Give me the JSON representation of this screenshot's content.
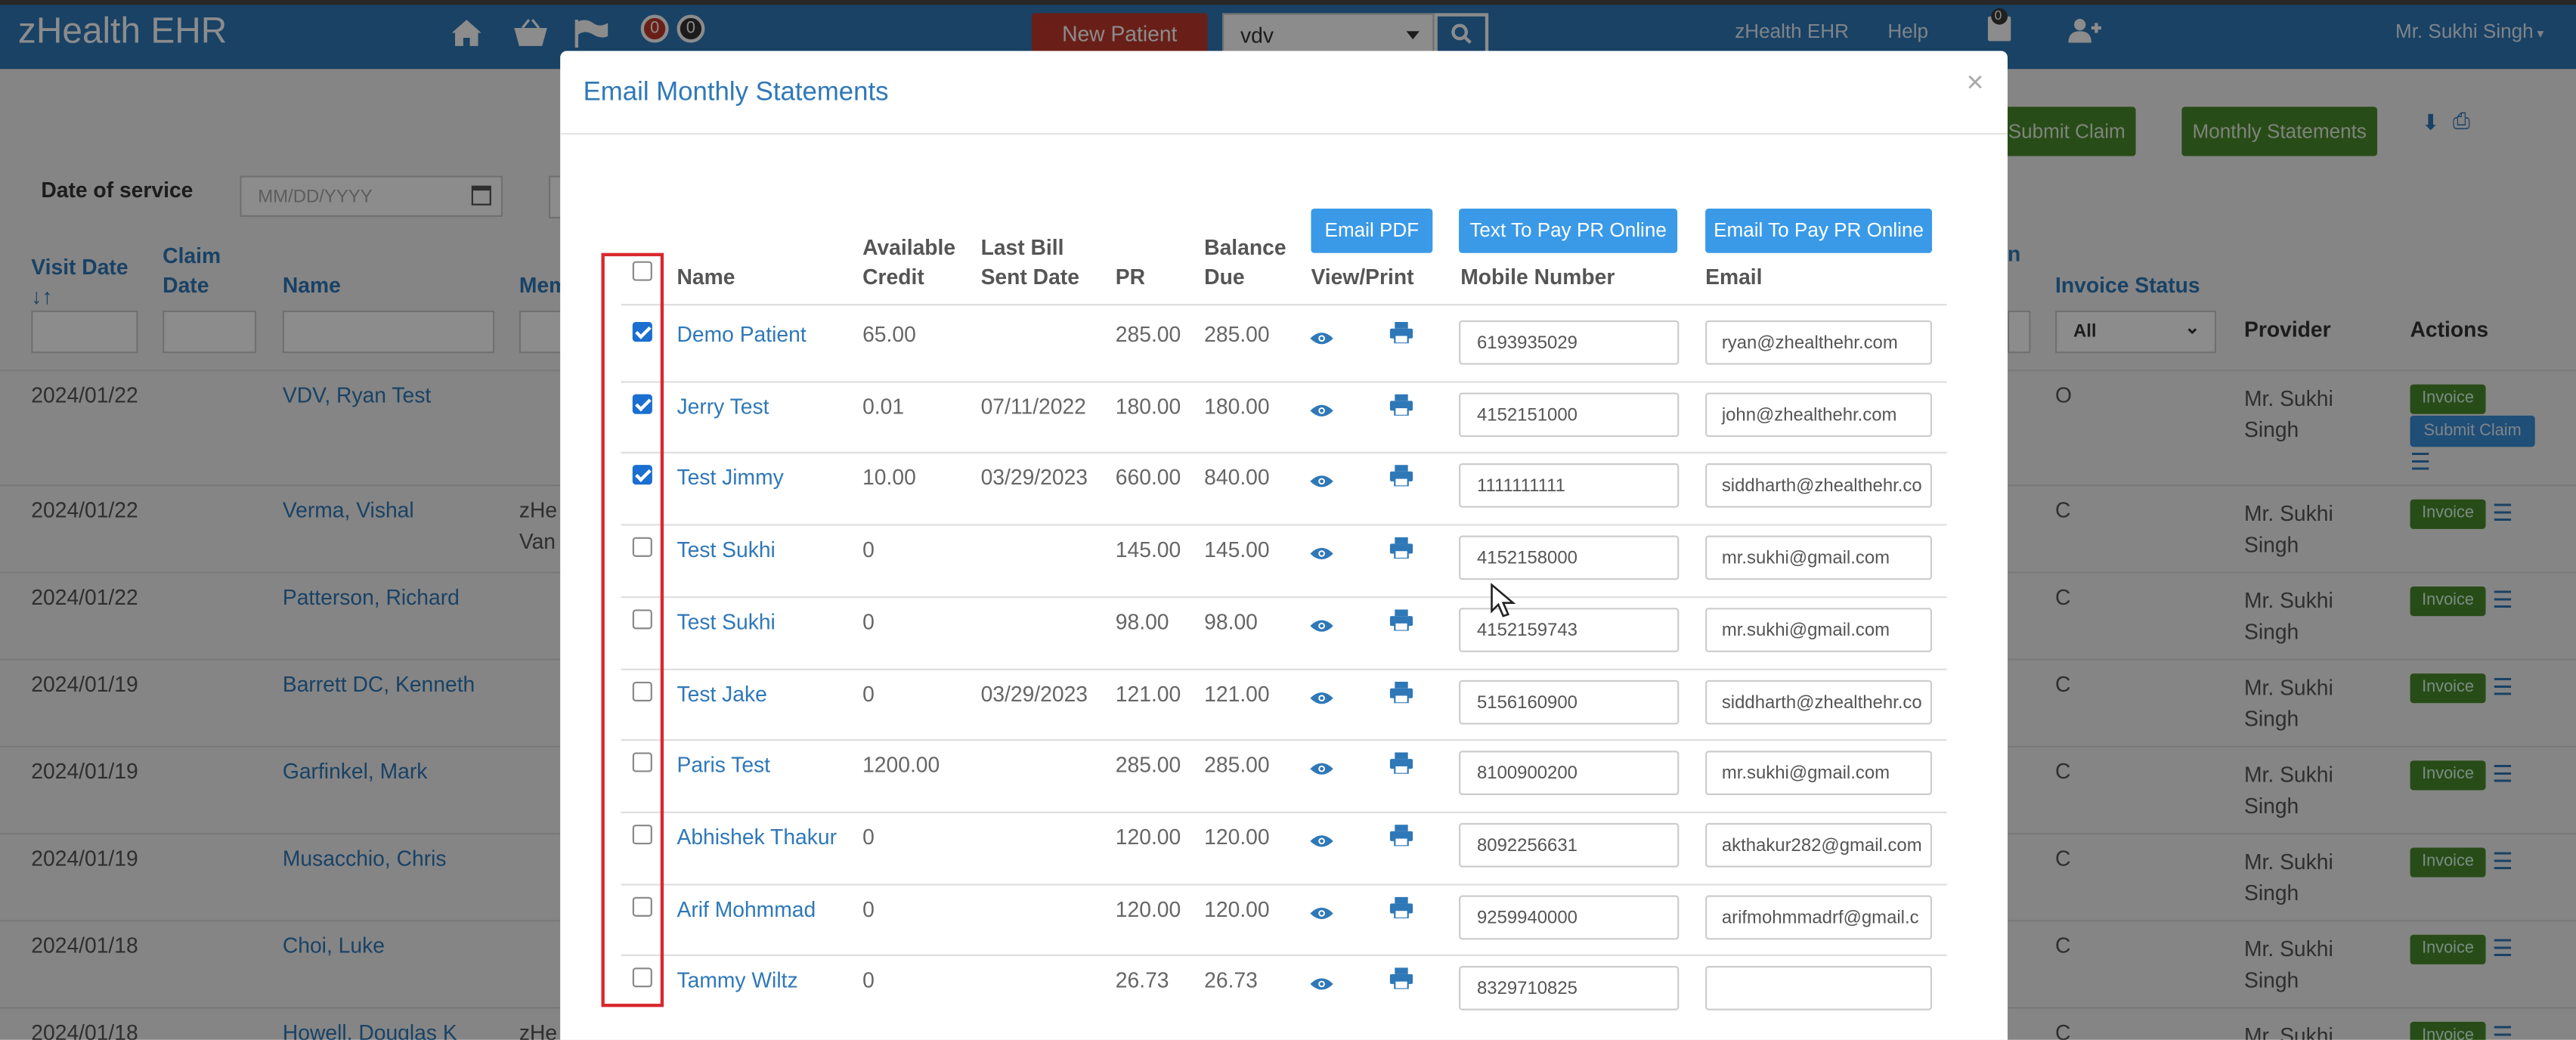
{
  "navbar": {
    "brand": "zHealth EHR",
    "new_patient": "New Patient",
    "search_value": "vdv",
    "badge_1": "0",
    "badge_2": "0",
    "app_link": "zHealth EHR",
    "help": "Help",
    "cart_badge": "0",
    "user": "Mr. Sukhi Singh"
  },
  "toolbar": {
    "submit_claim": "Submit Claim",
    "monthly_statements": "Monthly Statements"
  },
  "filters": {
    "date_of_service": "Date of service",
    "date_placeholder": "MM/DD/YYYY",
    "status_all": "All"
  },
  "bg_headers": {
    "visit_date": "Visit Date",
    "sort": "↓↑",
    "claim_date": "Claim Date",
    "name": "Name",
    "member": "Mem",
    "n": "n",
    "invoice_status": "Invoice Status",
    "provider": "Provider",
    "actions": "Actions"
  },
  "bg_rows": [
    {
      "date": "2024/01/22",
      "name": "VDV, Ryan Test",
      "status": "O",
      "provider": "Mr. Sukhi Singh"
    },
    {
      "date": "2024/01/22",
      "name": "Verma, Vishal",
      "status": "C",
      "provider": "Mr. Sukhi Singh",
      "member": "zHe",
      "member2": "Van"
    },
    {
      "date": "2024/01/22",
      "name": "Patterson, Richard",
      "status": "C",
      "provider": "Mr. Sukhi Singh"
    },
    {
      "date": "2024/01/19",
      "name": "Barrett DC, Kenneth",
      "status": "C",
      "provider": "Mr. Sukhi Singh"
    },
    {
      "date": "2024/01/19",
      "name": "Garfinkel, Mark",
      "status": "C",
      "provider": "Mr. Sukhi Singh"
    },
    {
      "date": "2024/01/19",
      "name": "Musacchio, Chris",
      "status": "C",
      "provider": "Mr. Sukhi Singh"
    },
    {
      "date": "2024/01/18",
      "name": "Choi, Luke",
      "status": "C",
      "provider": "Mr. Sukhi Singh"
    },
    {
      "date": "2024/01/18",
      "name": "Howell, Douglas K",
      "status": "C",
      "provider": "Mr. Sukhi",
      "member": "zHe"
    }
  ],
  "invoice_label": "Invoice",
  "submit_claim_small": "Submit Claim",
  "modal": {
    "title": "Email Monthly Statements",
    "close": "×",
    "btn_email_pdf": "Email PDF",
    "btn_text_pay": "Text To Pay PR Online",
    "btn_email_pay": "Email To Pay PR Online",
    "headers": {
      "name": "Name",
      "credit_1": "Available",
      "credit_2": "Credit",
      "last_1": "Last Bill",
      "last_2": "Sent Date",
      "pr": "PR",
      "bal_1": "Balance",
      "bal_2": "Due",
      "view": "View/Print",
      "mobile": "Mobile Number",
      "email": "Email"
    },
    "rows": [
      {
        "checked": true,
        "name": "Demo Patient",
        "credit": "65.00",
        "last": "",
        "pr": "285.00",
        "bal": "285.00",
        "mobile": "6193935029",
        "email": "ryan@zhealthehr.com"
      },
      {
        "checked": true,
        "name": "Jerry Test",
        "credit": "0.01",
        "last": "07/11/2022",
        "pr": "180.00",
        "bal": "180.00",
        "mobile": "4152151000",
        "email": "john@zhealthehr.com"
      },
      {
        "checked": true,
        "name": "Test Jimmy",
        "credit": "10.00",
        "last": "03/29/2023",
        "pr": "660.00",
        "bal": "840.00",
        "mobile": "1111111111",
        "email": "siddharth@zhealthehr.co"
      },
      {
        "checked": false,
        "name": "Test Sukhi",
        "credit": "0",
        "last": "",
        "pr": "145.00",
        "bal": "145.00",
        "mobile": "4152158000",
        "email": "mr.sukhi@gmail.com"
      },
      {
        "checked": false,
        "name": "Test Sukhi",
        "credit": "0",
        "last": "",
        "pr": "98.00",
        "bal": "98.00",
        "mobile": "4152159743",
        "email": "mr.sukhi@gmail.com"
      },
      {
        "checked": false,
        "name": "Test Jake",
        "credit": "0",
        "last": "03/29/2023",
        "pr": "121.00",
        "bal": "121.00",
        "mobile": "5156160900",
        "email": "siddharth@zhealthehr.co"
      },
      {
        "checked": false,
        "name": "Paris Test",
        "credit": "1200.00",
        "last": "",
        "pr": "285.00",
        "bal": "285.00",
        "mobile": "8100900200",
        "email": "mr.sukhi@gmail.com"
      },
      {
        "checked": false,
        "name": "Abhishek Thakur",
        "credit": "0",
        "last": "",
        "pr": "120.00",
        "bal": "120.00",
        "mobile": "8092256631",
        "email": "akthakur282@gmail.com"
      },
      {
        "checked": false,
        "name": "Arif Mohmmad",
        "credit": "0",
        "last": "",
        "pr": "120.00",
        "bal": "120.00",
        "mobile": "9259940000",
        "email": "arifmohmmadrf@gmail.c"
      },
      {
        "checked": false,
        "name": "Tammy Wiltz",
        "credit": "0",
        "last": "",
        "pr": "26.73",
        "bal": "26.73",
        "mobile": "8329710825",
        "email": ""
      }
    ]
  },
  "colors": {
    "nav": "#2f78b8",
    "danger": "#c0392b",
    "success": "#4a8a2a",
    "primary": "#3a9ae8",
    "highlight": "#d9282e"
  }
}
